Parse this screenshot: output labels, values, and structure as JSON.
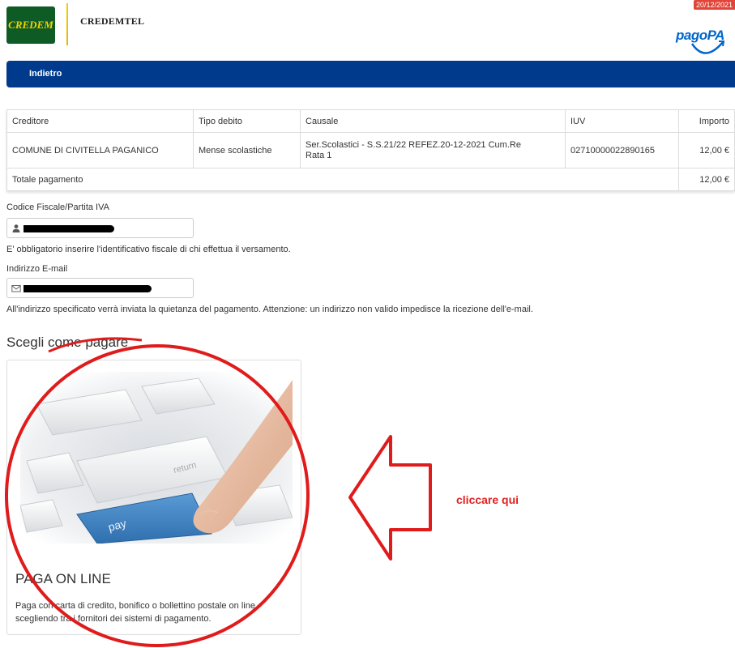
{
  "header": {
    "logo_text": "CREDEM",
    "brand": "CREDEMTEL",
    "date": "20/12/2021",
    "pagopa_logo": "pagoPA"
  },
  "nav": {
    "back_label": "Indietro"
  },
  "table": {
    "headers": [
      "Creditore",
      "Tipo debito",
      "Causale",
      "IUV",
      "Importo"
    ],
    "rows": [
      {
        "creditore": "COMUNE DI CIVITELLA PAGANICO",
        "tipo": "Mense scolastiche",
        "causale_line1": "Ser.Scolastici - S.S.21/22 REFEZ.20-12-2021 Cum.Re",
        "causale_line2": "Rata 1",
        "iuv": "02710000022890165",
        "importo": "12,00 €"
      }
    ],
    "total_label": "Totale pagamento",
    "total_value": "12,00 €"
  },
  "form": {
    "cf_label": "Codice Fiscale/Partita IVA",
    "cf_icon": "user-icon",
    "cf_hint": "E' obbligatorio inserire l'identificativo fiscale di chi effettua il versamento.",
    "email_label": "Indirizzo E-mail",
    "email_icon": "envelope-icon",
    "email_hint": "All'indirizzo specificato verrà inviata la quietanza del pagamento. Attenzione: un indirizzo non valido impedisce la ricezione dell'e-mail."
  },
  "payment": {
    "section_title": "Scegli come pagare",
    "card_title": "PAGA ON LINE",
    "card_description": "Paga con carta di credito, bonifico o bollettino postale on line, scegliendo tra i fornitori dei sistemi di pagamento.",
    "image_key_labels": {
      "return": "return",
      "pay": "pay"
    }
  },
  "annotation": {
    "text": "cliccare qui",
    "color": "#e02020"
  },
  "colors": {
    "navbar": "#003a8c",
    "credem_green": "#0f5b25",
    "credem_yellow": "#f4d200",
    "pay_key": "#3f87c6"
  }
}
